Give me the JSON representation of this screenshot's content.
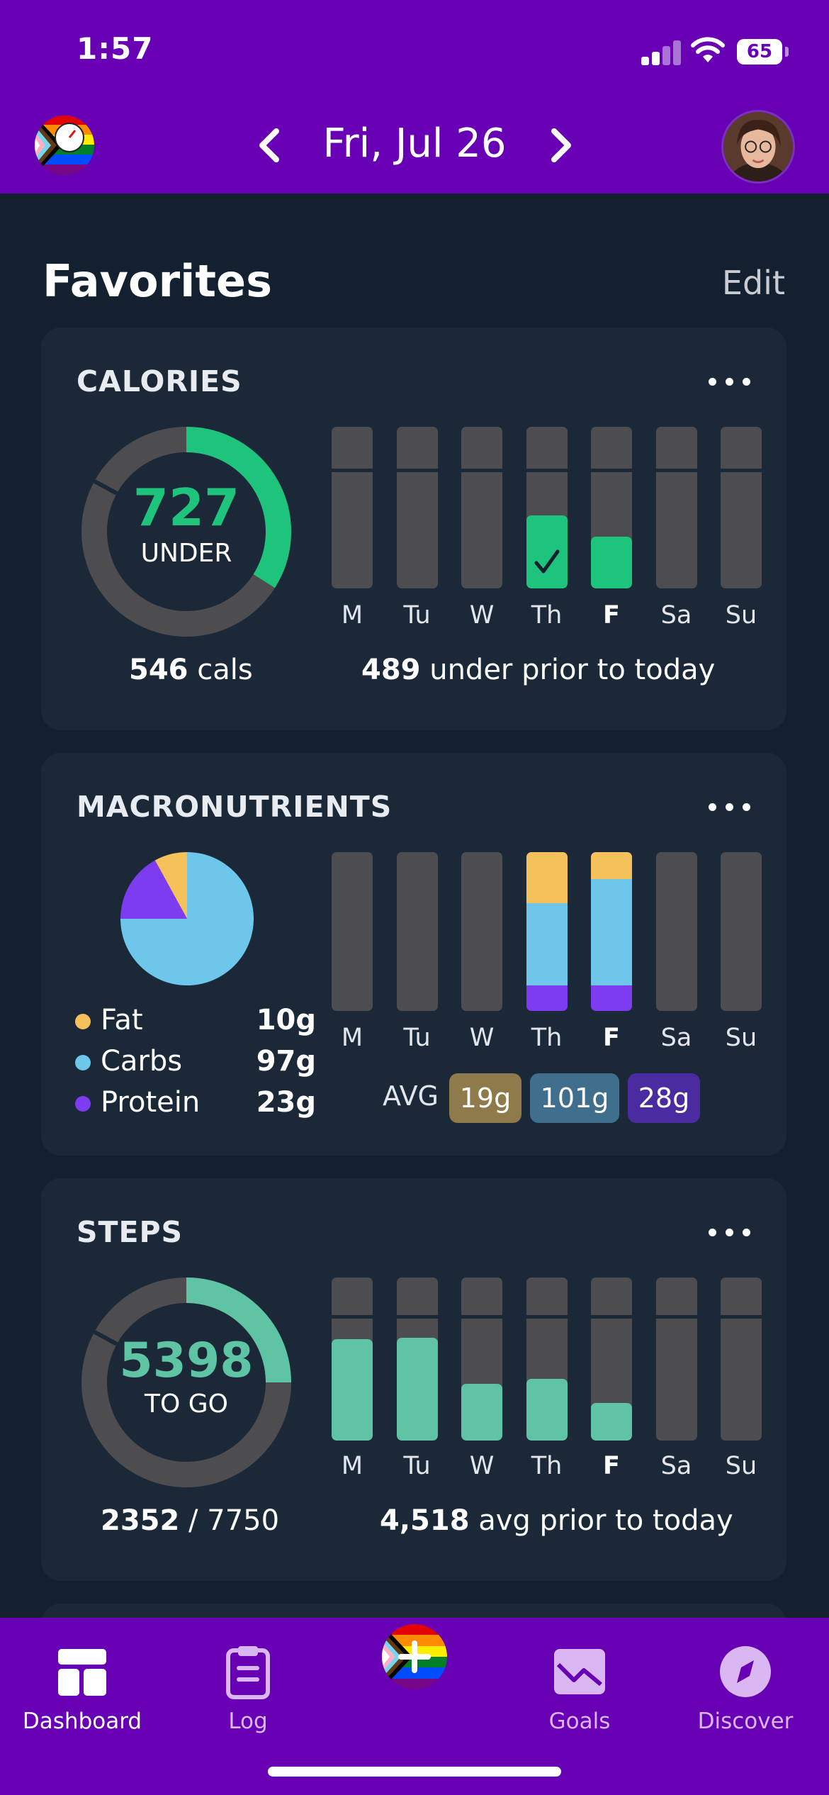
{
  "status_bar": {
    "time": "1:57",
    "battery": "65"
  },
  "header": {
    "date": "Fri, Jul 26"
  },
  "favorites": {
    "title": "Favorites",
    "edit_label": "Edit"
  },
  "days": [
    "M",
    "Tu",
    "W",
    "Th",
    "F",
    "Sa",
    "Su"
  ],
  "today_index": 4,
  "calories": {
    "title": "CALORIES",
    "ring_value": "727",
    "ring_label": "UNDER",
    "ring_progress": 0.34,
    "ring_color": "#1fc47c",
    "consumed": "546",
    "consumed_unit": "cals",
    "prior_value": "489",
    "prior_text": "under prior to today",
    "daily_fill": [
      0,
      0,
      0,
      0.45,
      0.32,
      0,
      0
    ],
    "goal_marker": 0.26,
    "goal_met_day": "Th"
  },
  "macros": {
    "title": "MACRONUTRIENTS",
    "legend": [
      {
        "name": "Fat",
        "value": "10g",
        "color": "#f5c15a"
      },
      {
        "name": "Carbs",
        "value": "97g",
        "color": "#6ec6ea"
      },
      {
        "name": "Protein",
        "value": "23g",
        "color": "#7d3cf0"
      }
    ],
    "pie_shares": [
      0.08,
      0.75,
      0.17
    ],
    "daily_split": [
      null,
      null,
      null,
      {
        "fat": 0.32,
        "carbs": 0.52,
        "protein": 0.16
      },
      {
        "fat": 0.17,
        "carbs": 0.67,
        "protein": 0.16
      },
      null,
      null
    ],
    "avg_label": "AVG",
    "avg": [
      {
        "value": "19g",
        "color": "#8e7a4a"
      },
      {
        "value": "101g",
        "color": "#3f6f8d"
      },
      {
        "value": "28g",
        "color": "#4a2ba0"
      }
    ]
  },
  "steps": {
    "title": "STEPS",
    "ring_value": "5398",
    "ring_label": "TO GO",
    "ring_progress": 0.25,
    "ring_color": "#5ec4a3",
    "current": "2352",
    "goal": "/ 7750",
    "prior_value": "4,518",
    "prior_text": "avg prior to today",
    "daily_fill": [
      0.62,
      0.63,
      0.35,
      0.38,
      0.23,
      0,
      0
    ],
    "goal_marker": 0.23
  },
  "tabs": [
    {
      "label": "Dashboard",
      "icon": "dashboard-icon"
    },
    {
      "label": "Log",
      "icon": "clipboard-icon"
    },
    {
      "label": "Goals",
      "icon": "goals-icon"
    },
    {
      "label": "Discover",
      "icon": "compass-icon"
    }
  ],
  "colors": {
    "brand": "#6701b3",
    "background": "#13202f",
    "card": "#1a2838",
    "bar_empty": "#4d4d4f"
  }
}
